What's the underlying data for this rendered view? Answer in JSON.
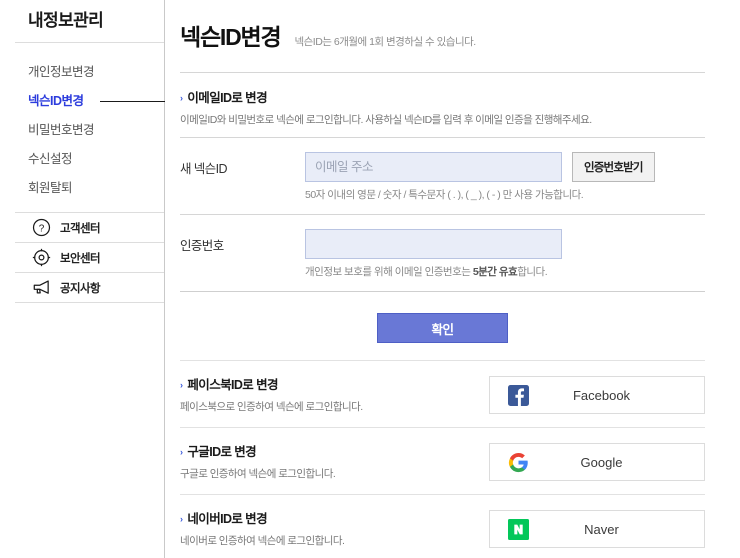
{
  "sidebar": {
    "title": "내정보관리",
    "nav_items": [
      {
        "label": "개인정보변경",
        "active": false
      },
      {
        "label": "넥슨ID변경",
        "active": true
      },
      {
        "label": "비밀번호변경",
        "active": false
      },
      {
        "label": "수신설정",
        "active": false
      },
      {
        "label": "회원탈퇴",
        "active": false
      }
    ],
    "links": [
      {
        "label": "고객센터",
        "icon": "question-circle-icon"
      },
      {
        "label": "보안센터",
        "icon": "security-target-icon"
      },
      {
        "label": "공지사항",
        "icon": "megaphone-icon"
      }
    ]
  },
  "page": {
    "title": "넥슨ID변경",
    "subtitle": "넥슨ID는 6개월에 1회 변경하실 수 있습니다."
  },
  "email_section": {
    "arrow": "›",
    "heading": "이메일ID로 변경",
    "description": "이메일ID와 비밀번호로 넥슨에 로그인합니다. 사용하실 넥슨ID를 입력 후 이메일 인증을 진행해주세요.",
    "rows": [
      {
        "label": "새 넥슨ID",
        "placeholder": "이메일 주소",
        "value": "",
        "button": "인증번호받기",
        "hint_prefix": "50자 이내의 영문 / 숫자 / 특수문자 ( . ), ( _ ), ( - ) 만 사용 가능합니다.",
        "hint_bold": "",
        "hint_suffix": ""
      },
      {
        "label": "인증번호",
        "placeholder": "",
        "value": "",
        "button": "",
        "hint_prefix": "개인정보 보호를 위해 이메일 인증번호는 ",
        "hint_bold": "5분간 유효",
        "hint_suffix": "합니다."
      }
    ],
    "submit_label": "확인"
  },
  "social_sections": [
    {
      "arrow": "›",
      "heading": "페이스북ID로 변경",
      "description": "페이스북으로 인증하여 넥슨에 로그인합니다.",
      "button_label": "Facebook",
      "icon": "facebook-icon",
      "brand_color": "#3b5998"
    },
    {
      "arrow": "›",
      "heading": "구글ID로 변경",
      "description": "구글로 인증하여 넥슨에 로그인합니다.",
      "button_label": "Google",
      "icon": "google-icon",
      "brand_color": "#4285F4"
    },
    {
      "arrow": "›",
      "heading": "네이버ID로 변경",
      "description": "네이버로 인증하여 넥슨에 로그인합니다.",
      "button_label": "Naver",
      "icon": "naver-icon",
      "brand_color": "#03C75A"
    }
  ],
  "colors": {
    "accent_blue": "#2c3cdd",
    "submit_blue": "#6978d6",
    "input_bg": "#e9edf8",
    "input_border": "#b9c4e2"
  }
}
